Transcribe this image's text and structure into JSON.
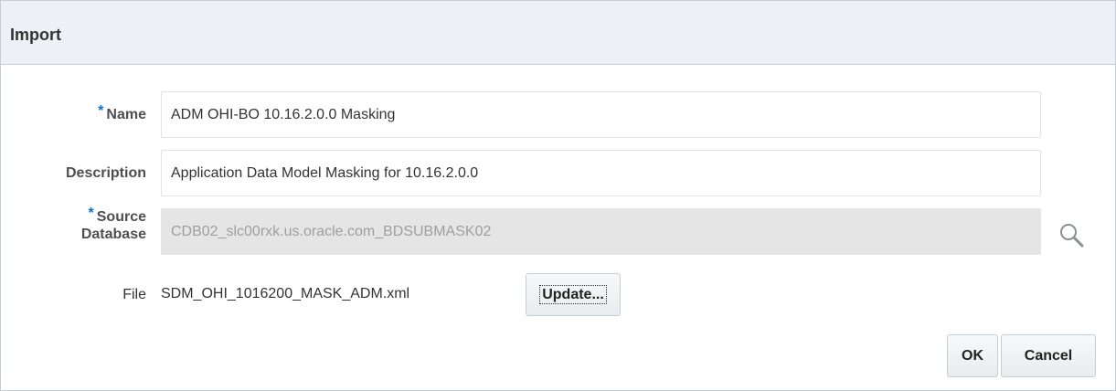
{
  "dialog": {
    "title": "Import"
  },
  "form": {
    "name": {
      "required_mark": "*",
      "label": "Name",
      "value": "ADM OHI-BO 10.16.2.0.0 Masking"
    },
    "description": {
      "label": "Description",
      "value": "Application Data Model Masking for 10.16.2.0.0"
    },
    "source_database": {
      "required_mark": "*",
      "label_line1": "Source",
      "label_line2": "Database",
      "value": "CDB02_slc00rxk.us.oracle.com_BDSUBMASK02",
      "search_icon": "magnifier-icon"
    },
    "file": {
      "label": "File",
      "value": "SDM_OHI_1016200_MASK_ADM.xml",
      "update_label": "Update..."
    }
  },
  "footer": {
    "ok_label": "OK",
    "cancel_label": "Cancel"
  },
  "colors": {
    "required_star": "#0572ce",
    "header_bg": "#edf1f5",
    "disabled_field_bg": "#e5e5e5"
  }
}
